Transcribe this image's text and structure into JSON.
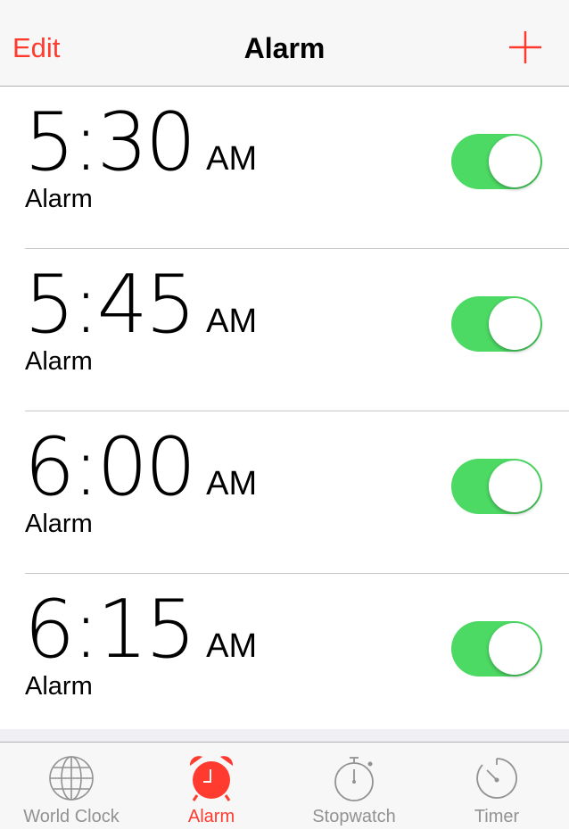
{
  "colors": {
    "accent": "#ff3b30",
    "toggle_on": "#4cd964",
    "tab_inactive": "#929292"
  },
  "navbar": {
    "edit_label": "Edit",
    "title": "Alarm",
    "add_icon": "plus-icon"
  },
  "alarms": [
    {
      "time": "5:30",
      "ampm": "AM",
      "label": "Alarm",
      "enabled": true
    },
    {
      "time": "5:45",
      "ampm": "AM",
      "label": "Alarm",
      "enabled": true
    },
    {
      "time": "6:00",
      "ampm": "AM",
      "label": "Alarm",
      "enabled": true
    },
    {
      "time": "6:15",
      "ampm": "AM",
      "label": "Alarm",
      "enabled": true
    }
  ],
  "tabbar": {
    "items": [
      {
        "label": "World Clock",
        "icon": "globe-icon",
        "active": false
      },
      {
        "label": "Alarm",
        "icon": "alarm-clock-icon",
        "active": true
      },
      {
        "label": "Stopwatch",
        "icon": "stopwatch-icon",
        "active": false
      },
      {
        "label": "Timer",
        "icon": "timer-icon",
        "active": false
      }
    ]
  }
}
